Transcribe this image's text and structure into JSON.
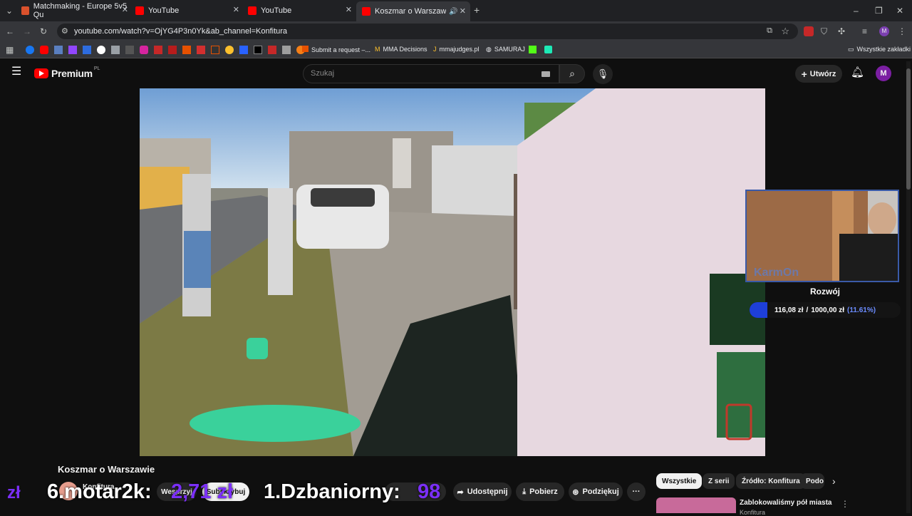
{
  "browser": {
    "tabs": [
      {
        "title": "Matchmaking - Europe 5v5 Qu",
        "color": "#d9512c"
      },
      {
        "title": "YouTube",
        "color": "#ff0000"
      },
      {
        "title": "YouTube",
        "color": "#ff0000"
      },
      {
        "title": "Koszmar o Warszawie - You",
        "color": "#ff0000"
      }
    ],
    "new_tab": "+",
    "url": "youtube.com/watch?v=OjYG4P3n0Yk&ab_channel=Konfitura",
    "bookmarks": [
      {
        "label": "Submit a request –..."
      },
      {
        "label": "MMA Decisions"
      },
      {
        "label": "mmajudges.pl"
      },
      {
        "label": "SAMURAJ"
      }
    ],
    "all_bookmarks": "Wszystkie zakładki"
  },
  "youtube": {
    "logo_text": "Premium",
    "logo_sup": "PL",
    "search_placeholder": "Szukaj",
    "create_label": "Utwórz",
    "avatar_letter": "M"
  },
  "video": {
    "title": "Koszmar o Warszawie",
    "channel": "Konfitura",
    "actions": {
      "support": "Wesprzyj",
      "subscribe": "Subskrybuj",
      "share": "Udostępnij",
      "download": "Pobierz",
      "thanks": "Podziękuj",
      "more": "···"
    }
  },
  "stream_overlay": {
    "streamer_watermark": "KarmOn",
    "goal_label": "Rozwój",
    "goal_current": "116,08 zł",
    "goal_target": "1000,00 zł",
    "goal_percent": "(11.61%)",
    "goal_fraction": 0.1161
  },
  "ticker": {
    "left_text": "6.motar2k:",
    "left_amount": "2,71 zł",
    "right_text": "1.Dzbaniorny:",
    "right_amount": "98"
  },
  "sidebar": {
    "chips": [
      "Wszystkie",
      "Z serii",
      "Źródło: Konfitura",
      "Podo"
    ],
    "next_video_title": "Zablokowaliśmy pół miasta",
    "next_video_channel": "Konfitura"
  }
}
